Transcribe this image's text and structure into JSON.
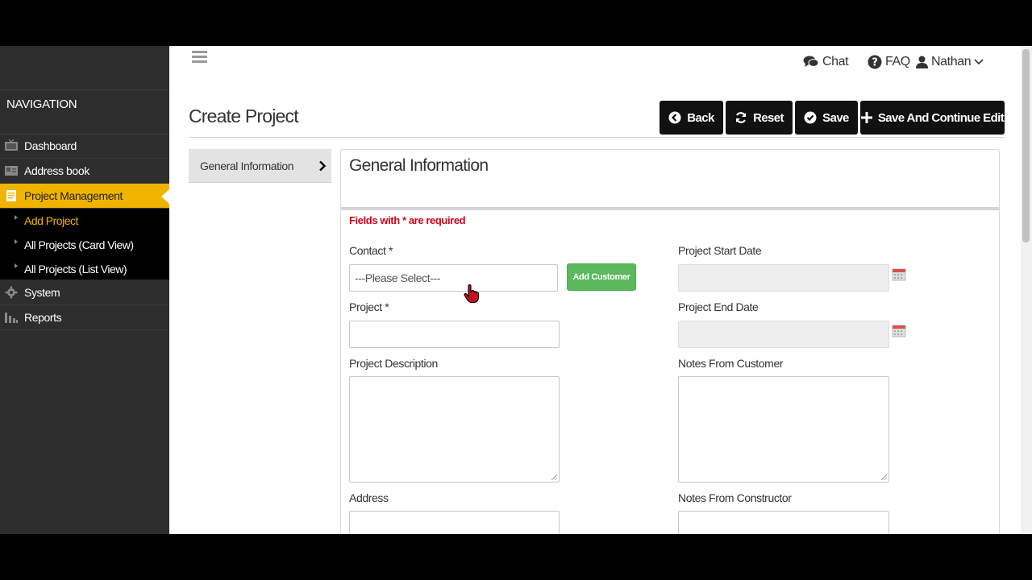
{
  "sidebar": {
    "title": "NAVIGATION",
    "items": [
      {
        "label": "Dashboard",
        "icon": "tv-icon"
      },
      {
        "label": "Address book",
        "icon": "address-book-icon"
      },
      {
        "label": "Project Management",
        "icon": "document-icon"
      },
      {
        "label": "System",
        "icon": "gear-icon"
      },
      {
        "label": "Reports",
        "icon": "bar-chart-icon"
      }
    ],
    "sub_items": [
      {
        "label": "Add Project"
      },
      {
        "label": "All Projects (Card View)"
      },
      {
        "label": "All Projects (List View)"
      }
    ]
  },
  "topbar": {
    "chat": "Chat",
    "faq": "FAQ",
    "user": "Nathan"
  },
  "page": {
    "title": "Create Project",
    "buttons": {
      "back": "Back",
      "reset": "Reset",
      "save": "Save",
      "save_continue": "Save And Continue Edit"
    }
  },
  "tabs": {
    "general": "General Information"
  },
  "form": {
    "title": "General Information",
    "required_note": "Fields with * are required",
    "contact_label": "Contact *",
    "contact_value": "---Please Select---",
    "add_customer": "Add Customer",
    "project_label": "Project *",
    "description_label": "Project Description",
    "address_label": "Address",
    "start_date_label": "Project Start Date",
    "end_date_label": "Project End Date",
    "notes_customer_label": "Notes From Customer",
    "notes_constructor_label": "Notes From Constructor"
  },
  "colors": {
    "accent": "#f0b400",
    "sidebar_bg": "#2d2d2d",
    "button_dark": "#111111",
    "add_button": "#5cb85c",
    "required": "#d0021b"
  }
}
